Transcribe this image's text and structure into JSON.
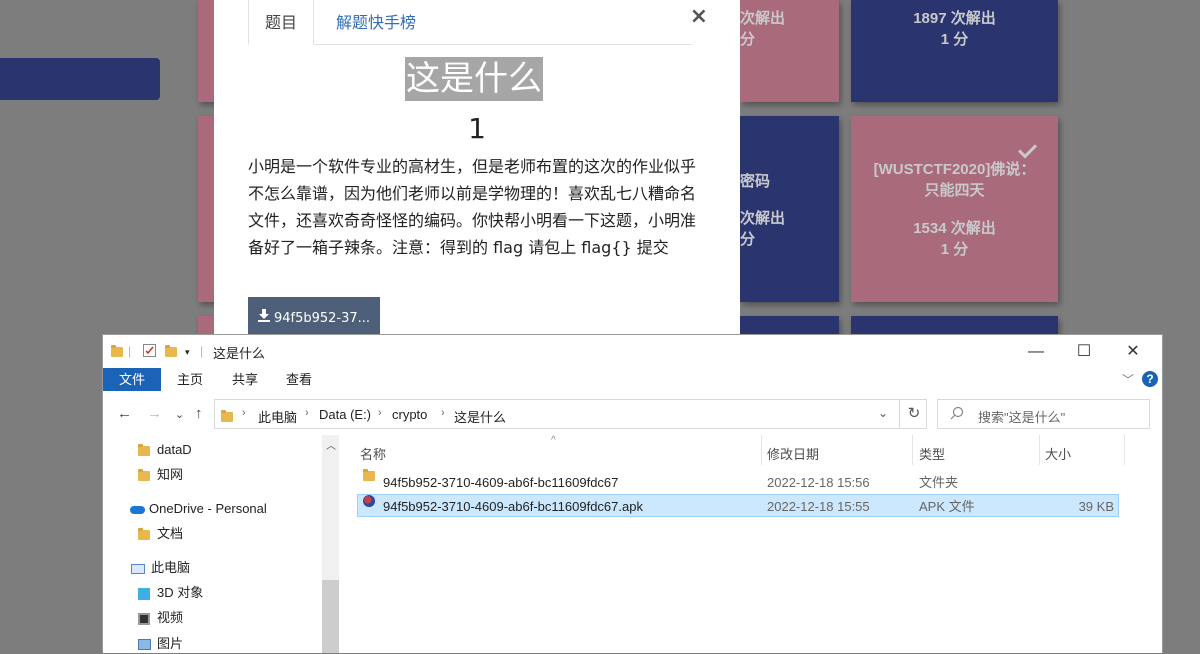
{
  "board": {
    "cards": [
      {
        "id": "c1",
        "theme": "pink",
        "title": "",
        "solves": "次解出",
        "points": "分"
      },
      {
        "id": "c2",
        "theme": "navy",
        "title": "",
        "solves": "1897 次解出",
        "points": "1 分"
      },
      {
        "id": "c3",
        "theme": "navy",
        "title": "密码",
        "solves": "次解出",
        "points": "分"
      },
      {
        "id": "c4",
        "theme": "pink",
        "title": "[WUSTCTF2020]佛说：只能四天",
        "solves": "1534 次解出",
        "points": "1 分",
        "solved": true
      }
    ]
  },
  "modal": {
    "tabs": [
      {
        "label": "题目",
        "active": true
      },
      {
        "label": "解题快手榜",
        "active": false
      }
    ],
    "close_label": "×",
    "challenge_name": "这是什么",
    "challenge_value": "1",
    "description": "小明是一个软件专业的高材生，但是老师布置的这次的作业似乎不怎么靠谱，因为他们老师以前是学物理的！喜欢乱七八糟命名文件，还喜欢奇奇怪怪的编码。你快帮小明看一下这题，小明准备好了一箱子辣条。注意：得到的 flag 请包上 flag{} 提交",
    "download_label": "94f5b952-37..."
  },
  "explorer": {
    "window_title": "这是什么",
    "controls": {
      "minimize": "—",
      "maximize": "☐",
      "close": "✕"
    },
    "ribbon_tabs": [
      "文件",
      "主页",
      "共享",
      "查看"
    ],
    "address": {
      "segments": [
        "此电脑",
        "Data (E:)",
        "crypto",
        "这是什么"
      ]
    },
    "search_placeholder": "搜索\"这是什么\"",
    "nav_items": [
      {
        "label": "dataD",
        "icon": "folder-icon"
      },
      {
        "label": "知网",
        "icon": "folder-icon"
      },
      {
        "label": "OneDrive - Personal",
        "icon": "onedrive-cloud-icon"
      },
      {
        "label": "文档",
        "icon": "folder-icon"
      },
      {
        "label": "此电脑",
        "icon": "this-pc-icon"
      },
      {
        "label": "3D 对象",
        "icon": "3d-objects-icon"
      },
      {
        "label": "视频",
        "icon": "video-icon"
      },
      {
        "label": "图片",
        "icon": "pictures-icon"
      }
    ],
    "columns": [
      "名称",
      "修改日期",
      "类型",
      "大小"
    ],
    "files": [
      {
        "name": "94f5b952-3710-4609-ab6f-bc11609fdc67",
        "date": "2022-12-18 15:56",
        "type": "文件夹",
        "size": "",
        "icon": "folder-icon",
        "selected": false
      },
      {
        "name": "94f5b952-3710-4609-ab6f-bc11609fdc67.apk",
        "date": "2022-12-18 15:55",
        "type": "APK 文件",
        "size": "39 KB",
        "icon": "apk-file-icon",
        "selected": true
      }
    ]
  }
}
